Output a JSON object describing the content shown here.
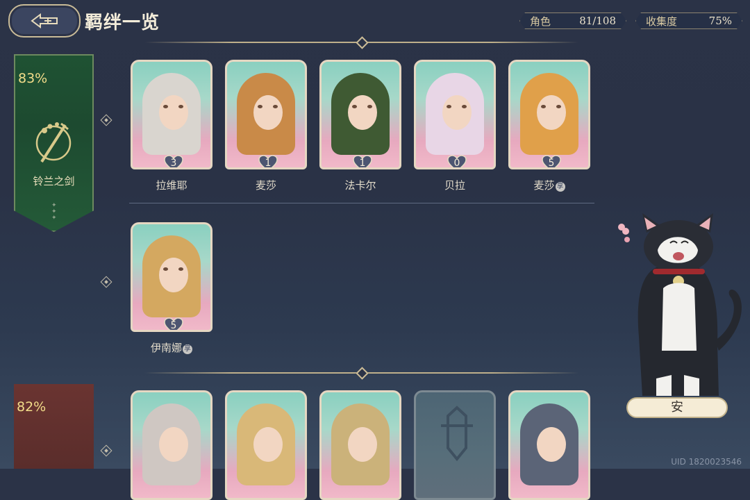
{
  "header": {
    "title": "羁绊一览",
    "stats": [
      {
        "label": "角色",
        "value": "81/108"
      },
      {
        "label": "收集度",
        "value": "75%"
      }
    ]
  },
  "groups": [
    {
      "percent": "83%",
      "name": "铃兰之剑",
      "color": "#1f5233",
      "rows": [
        [
          {
            "name": "拉维耶",
            "bond": "3",
            "hair": "#d9d5cf",
            "mark": false
          },
          {
            "name": "麦莎",
            "bond": "1",
            "hair": "#c98a48",
            "mark": false
          },
          {
            "name": "法卡尔",
            "bond": "1",
            "hair": "#3f5a33",
            "mark": false
          },
          {
            "name": "贝拉",
            "bond": "0",
            "hair": "#e8d6e6",
            "mark": false
          },
          {
            "name": "麦莎",
            "bond": "5",
            "hair": "#e0a04a",
            "mark": true
          }
        ],
        [
          {
            "name": "伊南娜",
            "bond": "5",
            "hair": "#d4a860",
            "mark": true
          }
        ]
      ]
    },
    {
      "percent": "82%",
      "color": "#6a3431"
    }
  ],
  "mark_glyph": "享",
  "companion": {
    "name": "安"
  },
  "footer": {
    "uid": "UID 1820023546"
  }
}
